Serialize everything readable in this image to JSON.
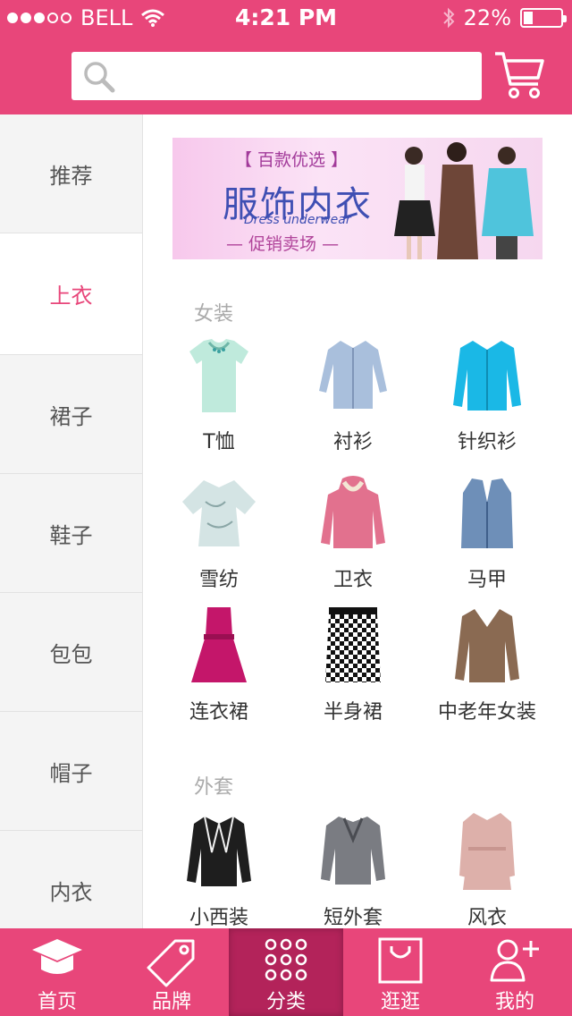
{
  "status_bar": {
    "carrier": "BELL",
    "time": "4:21 PM",
    "battery": "22%",
    "battery_level": 0.22
  },
  "search": {
    "placeholder": ""
  },
  "sidebar": {
    "items": [
      {
        "label": "推荐"
      },
      {
        "label": "上衣"
      },
      {
        "label": "裙子"
      },
      {
        "label": "鞋子"
      },
      {
        "label": "包包"
      },
      {
        "label": "帽子"
      },
      {
        "label": "内衣"
      }
    ],
    "active_index": 1
  },
  "banner": {
    "tag": "【 百款优选 】",
    "title": "服饰内衣",
    "subtitle": "Dress underwear",
    "promo": "— 促销卖场 —"
  },
  "sections": [
    {
      "title": "女装",
      "items": [
        {
          "label": "T恤",
          "icon": "tshirt-icon"
        },
        {
          "label": "衬衫",
          "icon": "shirt-icon"
        },
        {
          "label": "针织衫",
          "icon": "knit-cardigan-icon"
        },
        {
          "label": "雪纺",
          "icon": "chiffon-top-icon"
        },
        {
          "label": "卫衣",
          "icon": "hoodie-icon"
        },
        {
          "label": "马甲",
          "icon": "vest-icon"
        },
        {
          "label": "连衣裙",
          "icon": "dress-icon"
        },
        {
          "label": "半身裙",
          "icon": "skirt-icon"
        },
        {
          "label": "中老年女装",
          "icon": "sweater-icon"
        }
      ]
    },
    {
      "title": "外套",
      "items": [
        {
          "label": "小西装",
          "icon": "blazer-icon"
        },
        {
          "label": "短外套",
          "icon": "short-jacket-icon"
        },
        {
          "label": "风衣",
          "icon": "trench-coat-icon"
        }
      ]
    }
  ],
  "tabbar": {
    "items": [
      {
        "label": "首页",
        "icon": "home-cap-icon"
      },
      {
        "label": "品牌",
        "icon": "tag-icon"
      },
      {
        "label": "分类",
        "icon": "grid-dots-icon"
      },
      {
        "label": "逛逛",
        "icon": "shopping-bag-icon"
      },
      {
        "label": "我的",
        "icon": "user-add-icon"
      }
    ],
    "active_index": 2
  },
  "colors": {
    "brand": "#e8467a",
    "active_tab": "#b3235a",
    "sidebar_bg": "#f4f4f4"
  }
}
